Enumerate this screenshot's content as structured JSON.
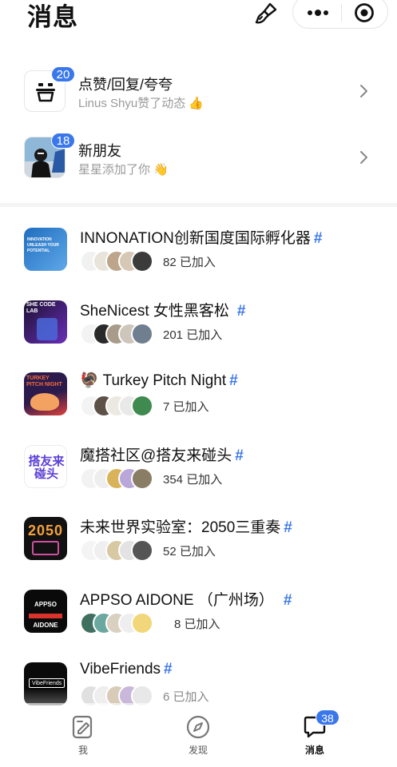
{
  "header": {
    "title": "消息",
    "brush_icon": "brush-icon",
    "more_icon": "more-dots-icon",
    "target_icon": "target-icon"
  },
  "notices": [
    {
      "title": "点赞/回复/夸夸",
      "sub": "Linus Shyu赞了动态 👍",
      "badge": "20",
      "icon": "smiley-box-icon"
    },
    {
      "title": "新朋友",
      "sub": "星星添加了你 👋",
      "badge": "18",
      "icon": "avatar-photo"
    }
  ],
  "groups": [
    {
      "title": "INNONATION创新国度国际孵化器",
      "hash": "#",
      "count": "82 已加入",
      "thumb_text": "INNOVATION UNLEASH YOUR POTENTIAL",
      "colors": [
        "#1f6dbf",
        "#5fa8e8"
      ]
    },
    {
      "title": "SheNicest 女性黑客松",
      "hash": "#",
      "count": "201 已加入",
      "thumb_text": "SHE CODE LAB",
      "colors": [
        "#1a1030",
        "#6a2fb8"
      ]
    },
    {
      "title": "🦃 Turkey Pitch Night",
      "hash": "#",
      "count": "7 已加入",
      "thumb_text": "TURKEY PITCH NIGHT",
      "colors": [
        "#2b1b4d",
        "#e0413b"
      ]
    },
    {
      "title": "魔搭社区@搭友来碰头",
      "hash": "#",
      "count": "354 已加入",
      "thumb_text": "搭友来碰头",
      "colors": [
        "#ffffff",
        "#5b3fd6"
      ]
    },
    {
      "title": "未来世界实验室：2050三重奏",
      "hash": "#",
      "count": "52 已加入",
      "thumb_text": "2050",
      "colors": [
        "#111111",
        "#f2a23a"
      ]
    },
    {
      "title": "APPSO AIDONE （广州场）",
      "hash": "#",
      "count": "8 已加入",
      "thumb_text": "APPSO AIDONE",
      "colors": [
        "#0a0a0a",
        "#d8342b"
      ]
    },
    {
      "title": "VibeFriends",
      "hash": "#",
      "count": "6 已加入",
      "thumb_text": "VibeFriends",
      "colors": [
        "#0a0a0a",
        "#555555"
      ]
    }
  ],
  "tabbar": {
    "tabs": [
      {
        "label": "我",
        "icon": "edit-note-icon"
      },
      {
        "label": "发现",
        "icon": "compass-icon"
      },
      {
        "label": "消息",
        "icon": "chat-bubble-icon",
        "badge": "38"
      }
    ]
  }
}
